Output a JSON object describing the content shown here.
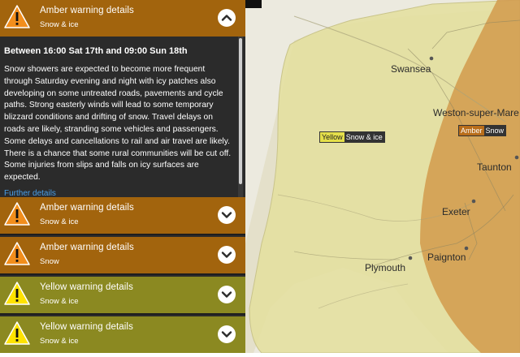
{
  "colors": {
    "amber_row": "#a2640d",
    "yellow_row": "#8b8921",
    "panel": "#2b2b2b",
    "map_bg": "#eceadf",
    "yellow_zone": "#e4df9e",
    "amber_zone": "#d29a4c",
    "link": "#4a9fe8"
  },
  "warnings": [
    {
      "level": "amber",
      "title": "Amber warning details",
      "subtitle": "Snow & ice",
      "icon": "warning-triangle-icon",
      "expanded": true
    },
    {
      "level": "amber",
      "title": "Amber warning details",
      "subtitle": "Snow & ice",
      "icon": "warning-triangle-icon",
      "expanded": false
    },
    {
      "level": "amber",
      "title": "Amber warning details",
      "subtitle": "Snow",
      "icon": "warning-triangle-icon",
      "expanded": false
    },
    {
      "level": "yellow",
      "title": "Yellow warning details",
      "subtitle": "Snow & ice",
      "icon": "warning-triangle-icon",
      "expanded": false
    },
    {
      "level": "yellow",
      "title": "Yellow warning details",
      "subtitle": "Snow & ice",
      "icon": "warning-triangle-icon",
      "expanded": false
    }
  ],
  "details": {
    "period": "Between 16:00 Sat 17th and 09:00 Sun 18th",
    "text": "Snow showers are expected to become more frequent through Saturday evening and night with icy patches also developing on some untreated roads, pavements and cycle paths. Strong easterly winds will lead to some temporary blizzard conditions and drifting of snow. Travel delays on roads are likely, stranding some vehicles and passengers. Some delays and cancellations to rail and air travel are likely. There is a chance that some rural communities will be cut off. Some injuries from slips and falls on icy surfaces are expected.",
    "link": "Further details"
  },
  "map": {
    "towns": [
      "Swansea",
      "Weston-super-Mare",
      "Taunton",
      "Exeter",
      "Paignton",
      "Plymouth"
    ],
    "yellow_label": {
      "level": "Yellow",
      "type": "Snow & ice"
    },
    "amber_label": {
      "level": "Amber",
      "type": "Snow"
    }
  }
}
